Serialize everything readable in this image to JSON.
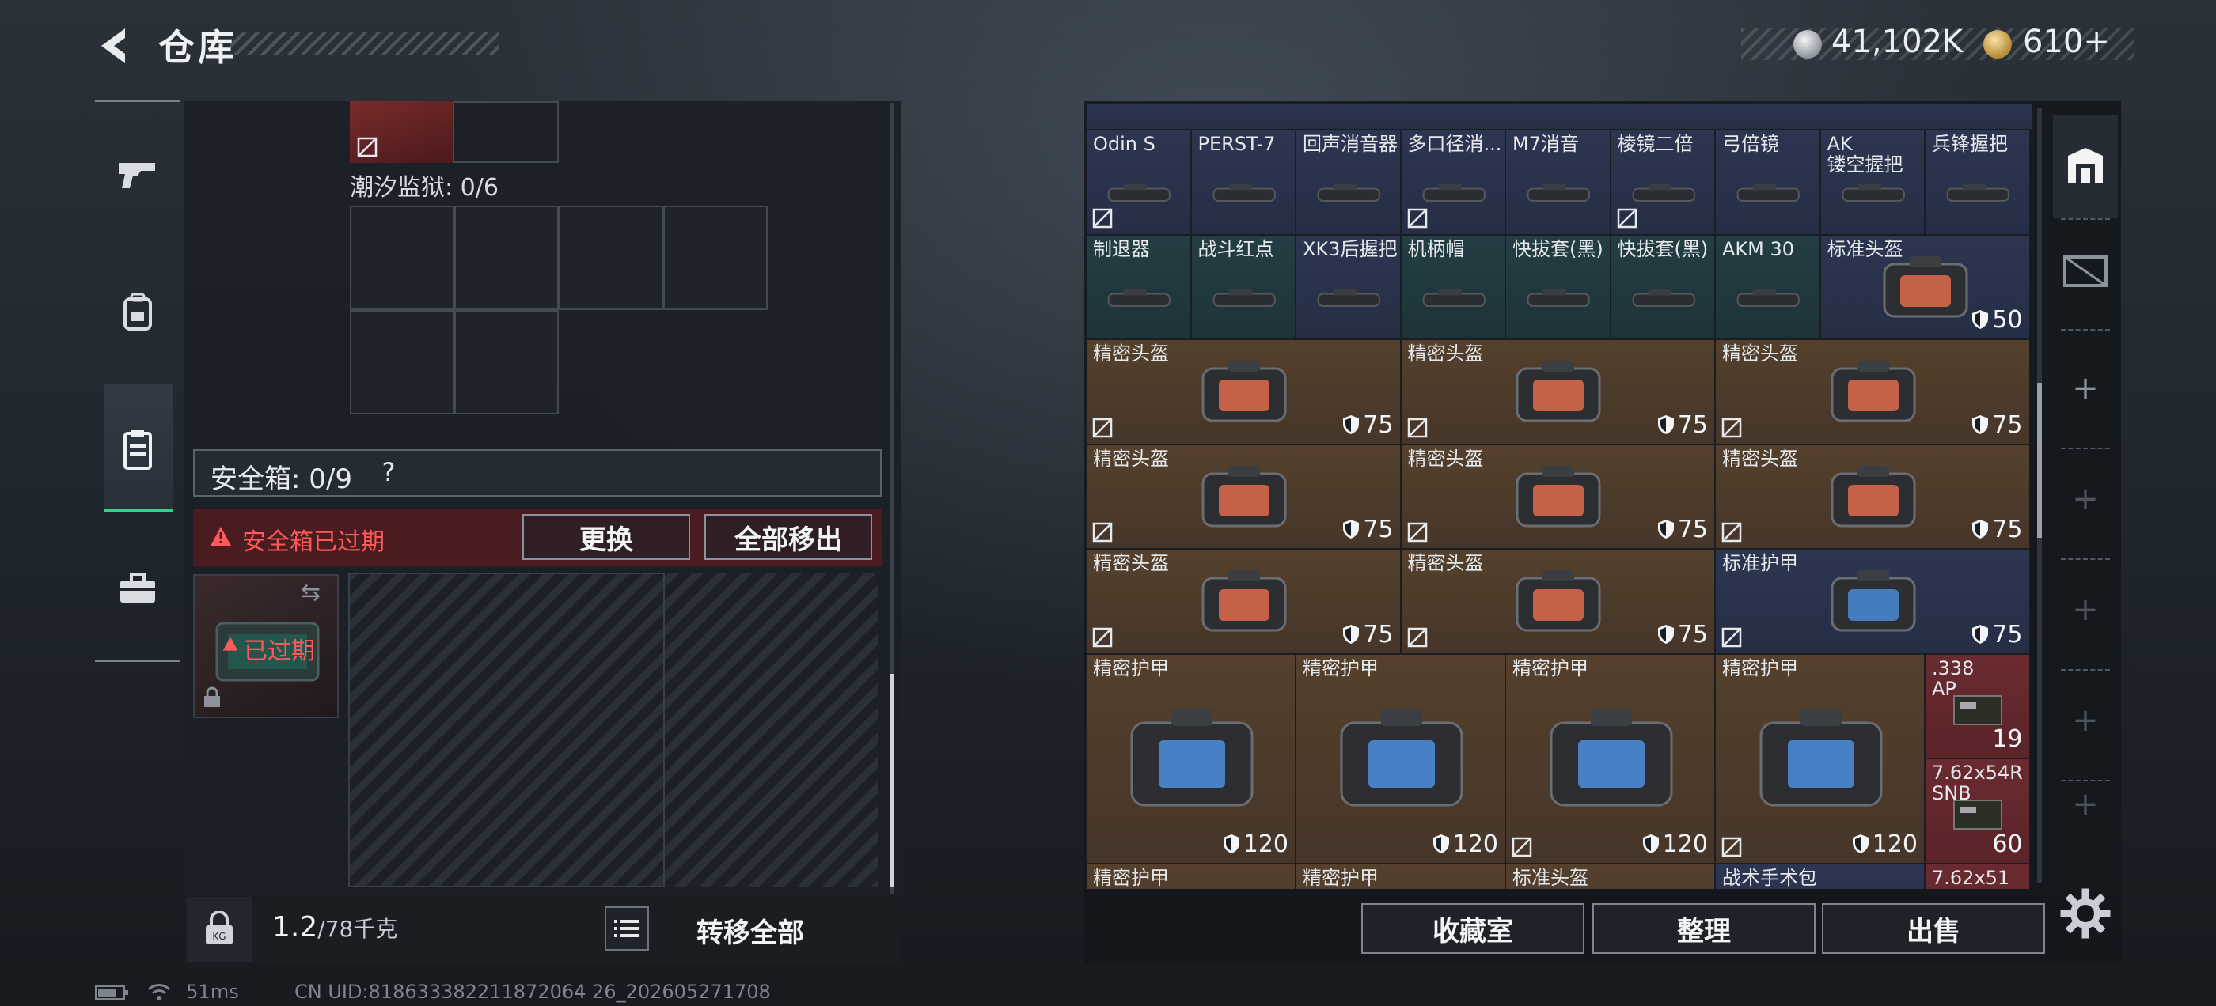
{
  "header": {
    "title": "仓库",
    "currency_primary": "41,102K",
    "currency_secondary": "610+",
    "colors": {
      "accent_green": "#36d08a",
      "warning_red": "#ff5a5a"
    }
  },
  "left_nav": {
    "items": [
      {
        "icon": "pistol-icon"
      },
      {
        "icon": "backpack-icon"
      },
      {
        "icon": "clipboard-icon",
        "active": true
      },
      {
        "icon": "briefcase-icon"
      }
    ]
  },
  "storage": {
    "container_label": "潮汐监狱: 0/6",
    "safe_box_label": "安全箱: 0/9",
    "help_symbol": "?",
    "expired_warning": "安全箱已过期",
    "swap_button": "更换",
    "move_all_button": "全部移出",
    "expired_badge": "已过期",
    "weight_value": "1.2",
    "weight_max": "/78千克",
    "transfer_all_button": "转移全部"
  },
  "inventory": {
    "rows": [
      [
        {
          "name": "Odin S",
          "color": "blue",
          "noicon": true
        },
        {
          "name": "PERST-7",
          "color": "blue"
        },
        {
          "name": "回声消音器",
          "color": "blue"
        },
        {
          "name": "多口径消...",
          "color": "blue",
          "noicon": true
        },
        {
          "name": "M7消音",
          "color": "blue"
        },
        {
          "name": "棱镜二倍",
          "color": "blue",
          "noicon": true
        },
        {
          "name": "弓倍镜",
          "color": "blue"
        },
        {
          "name": "AK\n镂空握把",
          "color": "blue"
        },
        {
          "name": "兵锋握把",
          "color": "blue"
        }
      ],
      [
        {
          "name": "制退器",
          "color": "teal"
        },
        {
          "name": "战斗红点",
          "color": "teal"
        },
        {
          "name": "XK3后握把",
          "color": "blue"
        },
        {
          "name": "机柄帽",
          "color": "teal"
        },
        {
          "name": "快拔套(黑)",
          "color": "teal"
        },
        {
          "name": "快拔套(黑)",
          "color": "teal"
        },
        {
          "name": "AKM 30",
          "color": "teal"
        },
        {
          "name": "标准头盔",
          "color": "blue",
          "durability": "50"
        }
      ]
    ],
    "precision_helmets": [
      {
        "name": "精密头盔",
        "durability": "75"
      },
      {
        "name": "精密头盔",
        "durability": "75"
      },
      {
        "name": "精密头盔",
        "durability": "75"
      },
      {
        "name": "精密头盔",
        "durability": "75"
      },
      {
        "name": "精密头盔",
        "durability": "75"
      },
      {
        "name": "精密头盔",
        "durability": "75"
      },
      {
        "name": "精密头盔",
        "durability": "75"
      },
      {
        "name": "精密头盔",
        "durability": "75"
      },
      {
        "name": "标准护甲",
        "durability": "75",
        "color": "blue"
      }
    ],
    "armors": [
      {
        "name": "精密护甲",
        "durability": "120"
      },
      {
        "name": "精密护甲",
        "durability": "120"
      },
      {
        "name": "精密护甲",
        "durability": "120"
      },
      {
        "name": "精密护甲",
        "durability": "120"
      }
    ],
    "ammo": [
      {
        "name": ".338\nAP",
        "count": "19"
      },
      {
        "name": "7.62x54R\nSNB",
        "count": "60"
      }
    ],
    "partial_row": [
      {
        "name": "精密护甲"
      },
      {
        "name": "精密护甲"
      },
      {
        "name": "标准头盔"
      },
      {
        "name": "战术手术包"
      },
      {
        "name": "7.62x51"
      }
    ]
  },
  "footer_buttons": {
    "collection": "收藏室",
    "organize": "整理",
    "sell": "出售"
  },
  "status": {
    "ping": "51ms",
    "uid": "CN UID:818633382211872064 26_202605271708"
  }
}
